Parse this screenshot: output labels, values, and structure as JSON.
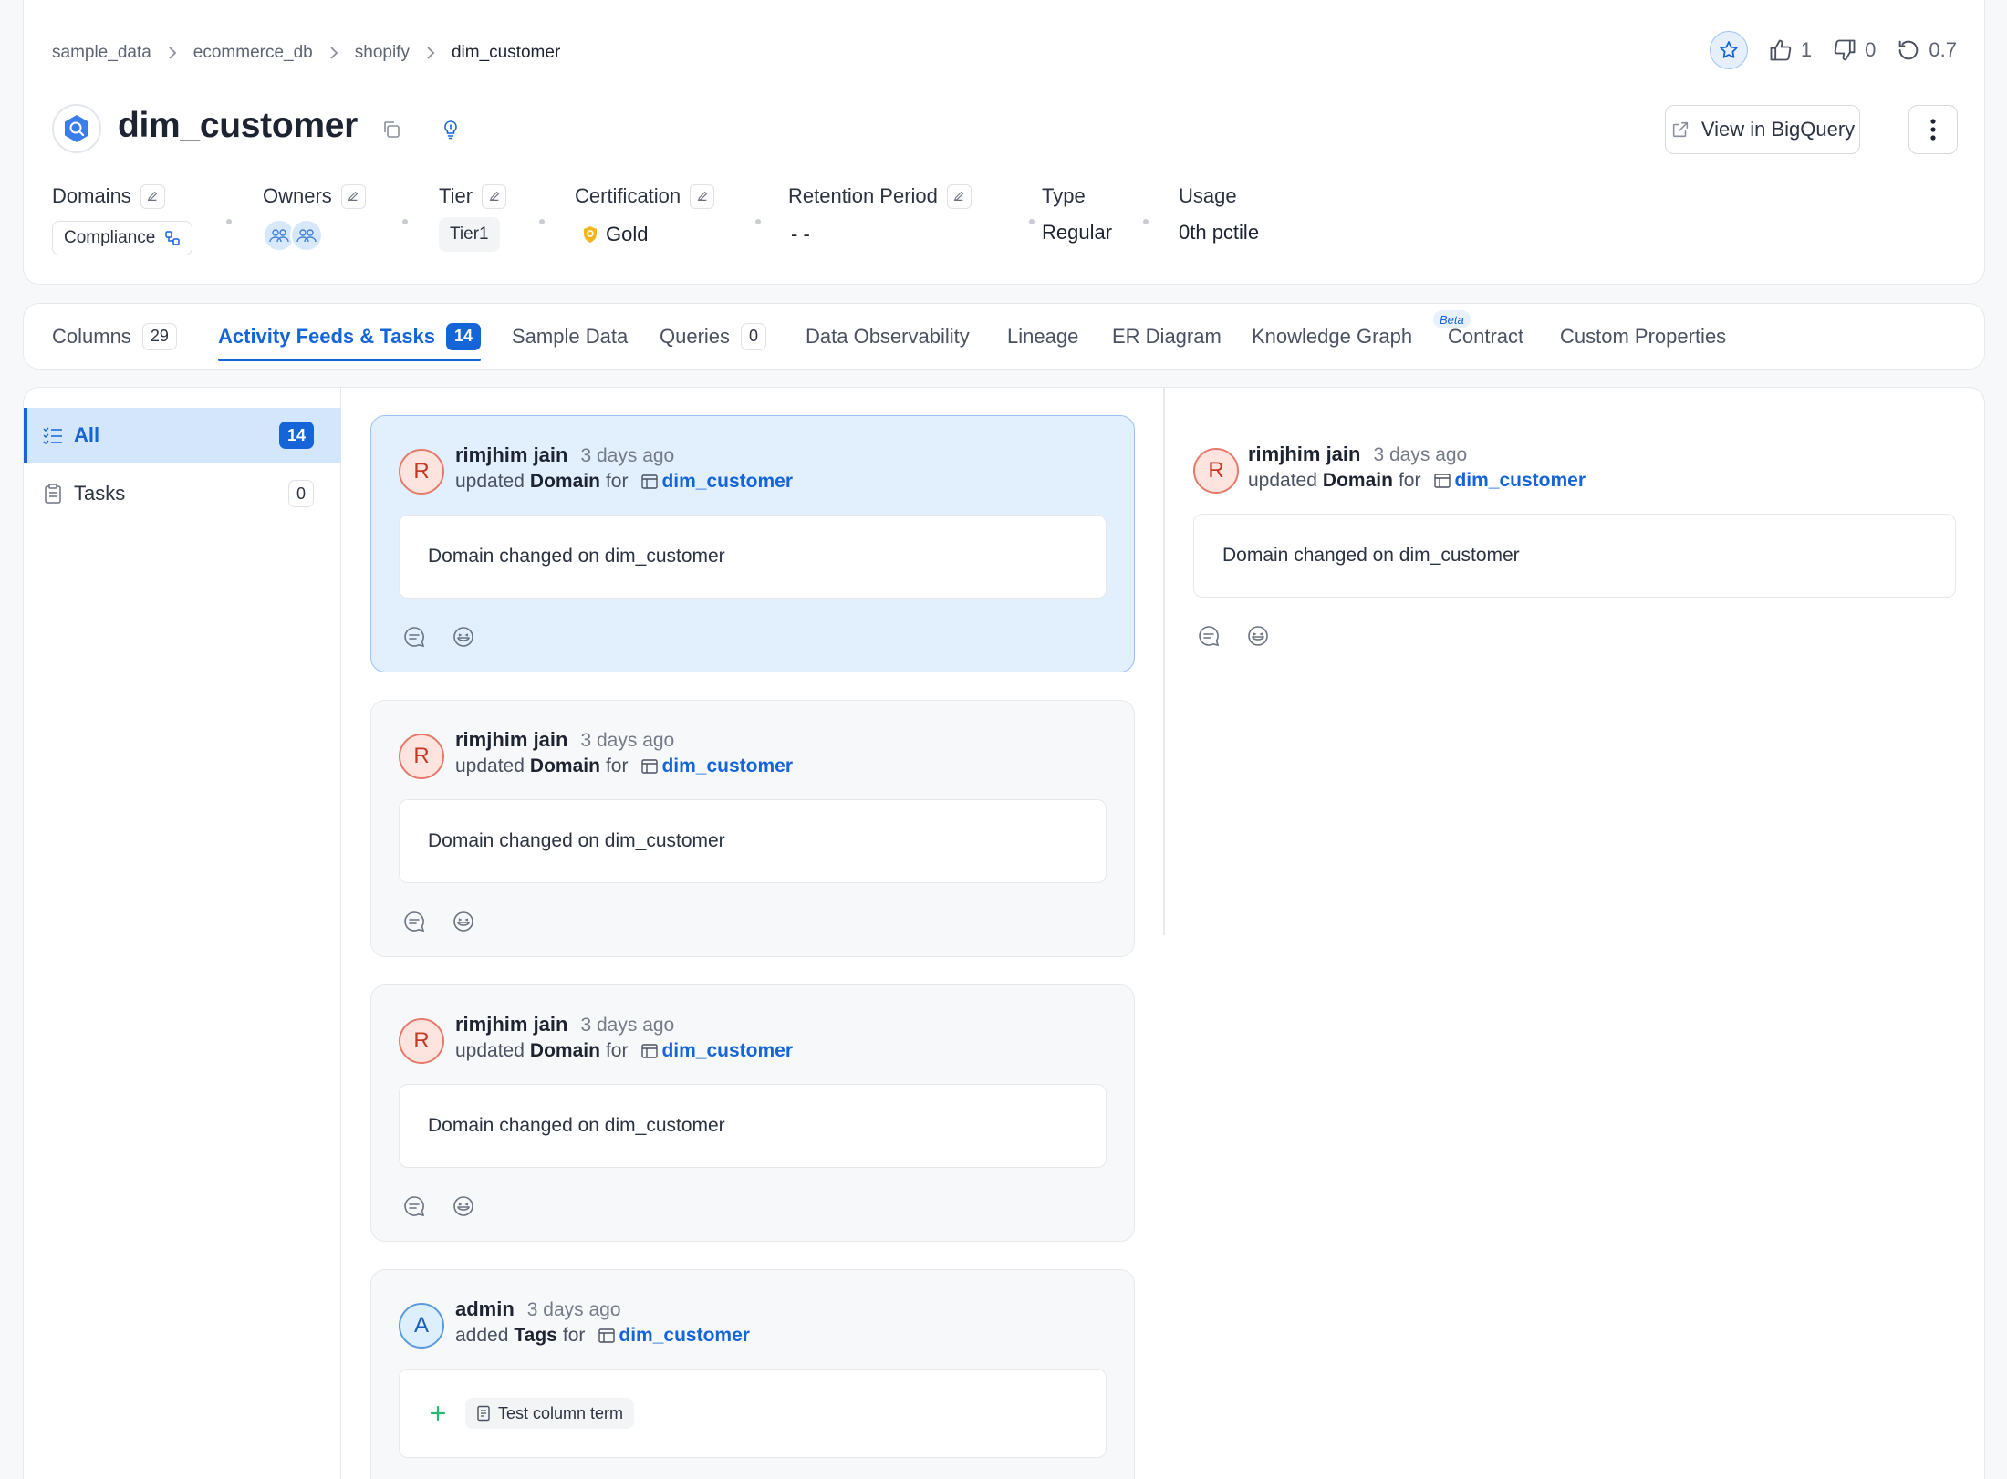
{
  "breadcrumb": [
    "sample_data",
    "ecommerce_db",
    "shopify",
    "dim_customer"
  ],
  "header": {
    "title": "dim_customer",
    "likes": "1",
    "dislikes": "0",
    "version": "0.7",
    "view_button": "View in BigQuery"
  },
  "meta": {
    "domains": {
      "label": "Domains",
      "value": "Compliance"
    },
    "owners": {
      "label": "Owners"
    },
    "tier": {
      "label": "Tier",
      "value": "Tier1"
    },
    "certification": {
      "label": "Certification",
      "value": "Gold"
    },
    "retention": {
      "label": "Retention Period",
      "value": "- -"
    },
    "type": {
      "label": "Type",
      "value": "Regular"
    },
    "usage": {
      "label": "Usage",
      "value": "0th pctile"
    }
  },
  "tabs": [
    {
      "label": "Columns",
      "count": "29"
    },
    {
      "label": "Activity Feeds & Tasks",
      "count": "14"
    },
    {
      "label": "Sample Data"
    },
    {
      "label": "Queries",
      "count": "0"
    },
    {
      "label": "Data Observability"
    },
    {
      "label": "Lineage"
    },
    {
      "label": "ER Diagram"
    },
    {
      "label": "Knowledge Graph",
      "badge": "Beta"
    },
    {
      "label": "Contract"
    },
    {
      "label": "Custom Properties"
    }
  ],
  "filters": [
    {
      "label": "All",
      "count": "14"
    },
    {
      "label": "Tasks",
      "count": "0"
    }
  ],
  "feeds": [
    {
      "initial": "R",
      "user": "rimjhim jain",
      "time": "3 days ago",
      "action": "updated",
      "field": "Domain",
      "for": "for",
      "entity": "dim_customer",
      "message": "Domain changed on dim_customer"
    },
    {
      "initial": "R",
      "user": "rimjhim jain",
      "time": "3 days ago",
      "action": "updated",
      "field": "Domain",
      "for": "for",
      "entity": "dim_customer",
      "message": "Domain changed on dim_customer"
    },
    {
      "initial": "R",
      "user": "rimjhim jain",
      "time": "3 days ago",
      "action": "updated",
      "field": "Domain",
      "for": "for",
      "entity": "dim_customer",
      "message": "Domain changed on dim_customer"
    },
    {
      "initial": "A",
      "user": "admin",
      "time": "3 days ago",
      "action": "added",
      "field": "Tags",
      "for": "for",
      "entity": "dim_customer",
      "tag": "Test column term"
    }
  ],
  "detail": {
    "initial": "R",
    "user": "rimjhim jain",
    "time": "3 days ago",
    "action": "updated",
    "field": "Domain",
    "for": "for",
    "entity": "dim_customer",
    "message": "Domain changed on dim_customer"
  },
  "colors": {
    "accent": "#1565d8",
    "gold": "#f2b51c",
    "selected_bg": "#e2effd"
  }
}
